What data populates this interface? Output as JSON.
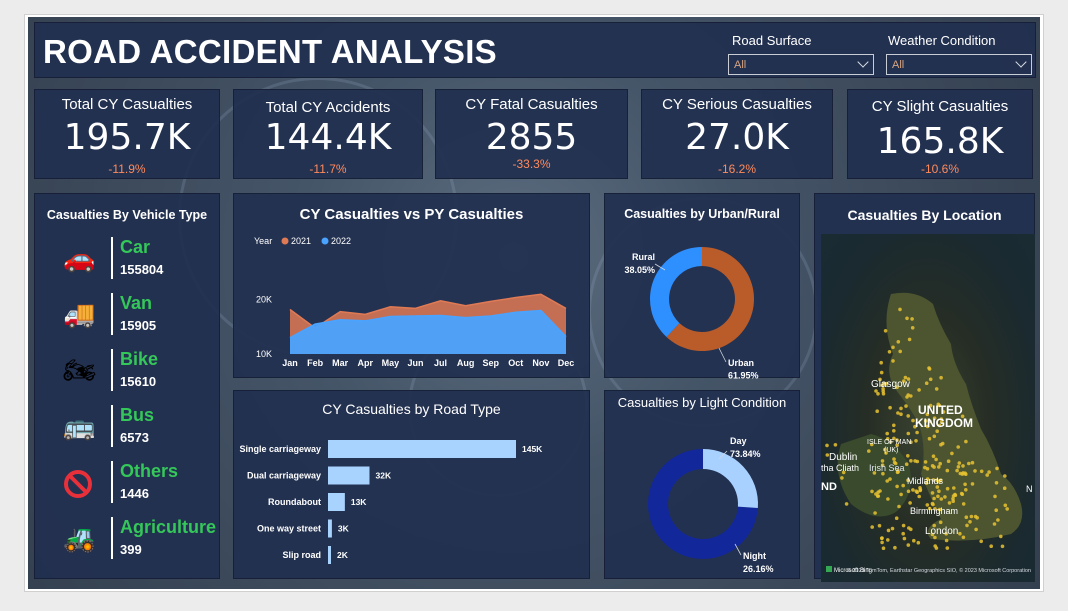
{
  "header": {
    "title": "ROAD ACCIDENT ANALYSIS"
  },
  "filters": [
    {
      "label": "Road Surface",
      "value": "All"
    },
    {
      "label": "Weather Condition",
      "value": "All"
    }
  ],
  "kpis": [
    {
      "label": "Total CY Casualties",
      "value": "195.7K",
      "delta": "-11.9%"
    },
    {
      "label": "Total CY Accidents",
      "value": "144.4K",
      "delta": "-11.7%"
    },
    {
      "label": "CY Fatal Casualties",
      "value": "2855",
      "delta": "-33.3%"
    },
    {
      "label": "CY Serious Casualties",
      "value": "27.0K",
      "delta": "-16.2%"
    },
    {
      "label": "CY Slight Casualties",
      "value": "165.8K",
      "delta": "-10.6%"
    }
  ],
  "vehicle": {
    "title": "Casualties By Vehicle Type",
    "items": [
      {
        "name": "Car",
        "count": "155804",
        "icon": "car-icon"
      },
      {
        "name": "Van",
        "count": "15905",
        "icon": "van-icon"
      },
      {
        "name": "Bike",
        "count": "15610",
        "icon": "bike-icon"
      },
      {
        "name": "Bus",
        "count": "6573",
        "icon": "bus-icon"
      },
      {
        "name": "Others",
        "count": "1446",
        "icon": "prohibited-icon"
      },
      {
        "name": "Agriculture",
        "count": "399",
        "icon": "tractor-icon"
      }
    ]
  },
  "colors": {
    "cy": "#4aa3ff",
    "py": "#e07a55",
    "urban": "#b95c2a",
    "rural": "#2e8fff",
    "day": "#12279a",
    "night": "#a8d1ff",
    "bar": "#a9d3ff"
  },
  "chart_data": [
    {
      "type": "area",
      "title": "CY Casualties vs PY Casualties",
      "legend_title": "Year",
      "categories": [
        "Jan",
        "Feb",
        "Mar",
        "Apr",
        "May",
        "Jun",
        "Jul",
        "Aug",
        "Sep",
        "Oct",
        "Nov",
        "Dec"
      ],
      "y_ticks": [
        "10K",
        "20K"
      ],
      "ylim": [
        10000,
        24000
      ],
      "series": [
        {
          "name": "2021",
          "values": [
            18200,
            14800,
            17800,
            17300,
            18700,
            18400,
            19800,
            18900,
            19700,
            20400,
            21000,
            18400
          ]
        },
        {
          "name": "2022",
          "values": [
            13000,
            15500,
            16300,
            16100,
            16900,
            17000,
            17100,
            16700,
            17000,
            17700,
            18000,
            13200
          ]
        }
      ]
    },
    {
      "type": "bar",
      "orientation": "horizontal",
      "title": "CY Casualties by Road Type",
      "categories": [
        "Single carriageway",
        "Dual carriageway",
        "Roundabout",
        "One way street",
        "Slip road"
      ],
      "values": [
        145000,
        32000,
        13000,
        3000,
        2000
      ],
      "labels": [
        "145K",
        "32K",
        "13K",
        "3K",
        "2K"
      ]
    },
    {
      "type": "pie",
      "title": "Casualties by Urban/Rural",
      "slices": [
        {
          "name": "Urban",
          "value": 61.95,
          "label": "61.95%"
        },
        {
          "name": "Rural",
          "value": 38.05,
          "label": "38.05%"
        }
      ]
    },
    {
      "type": "pie",
      "title": "Casualties by Light Condition",
      "slices": [
        {
          "name": "Day",
          "value": 73.84,
          "label": "73.84%"
        },
        {
          "name": "Night",
          "value": 26.16,
          "label": "26.16%"
        }
      ]
    }
  ],
  "map": {
    "title": "Casualties By Location",
    "labels": {
      "country": "UNITED",
      "country2": "KINGDOM",
      "glasgow": "Glasgow",
      "isle": "ISLE OF MAN",
      "isle2": "(UK)",
      "dublin": "Dublin",
      "cliath": "tha Cliath",
      "irish_sea": "Irish Sea",
      "nd": "ND",
      "midlands": "Midlands",
      "birmingham": "Birmingham",
      "london": "London",
      "n": "N"
    },
    "attribution": "© 2023 TomTom, Earthstar Geographics SIO, © 2023 Microsoft Corporation",
    "logo": "Microsoft Bing"
  }
}
